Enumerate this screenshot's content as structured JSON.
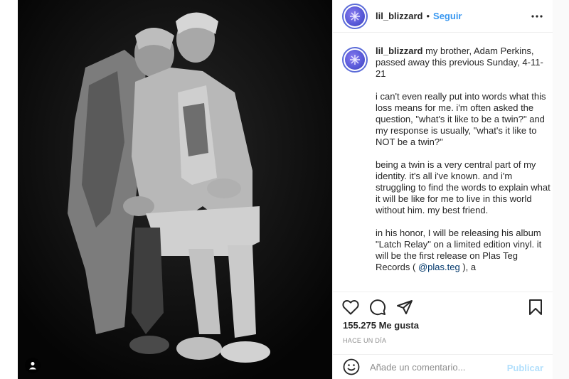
{
  "post": {
    "username": "lil_blizzard",
    "follow_label": "Seguir",
    "separator": "•",
    "photo_alt": "black-and-white portrait of two twins seated, one leaning on the other's shoulder"
  },
  "caption": {
    "username": "lil_blizzard",
    "first_line": " my brother, Adam Perkins, passed away this previous Sunday, 4-11-21",
    "paragraphs": [
      "i can't even really put into words what this loss means for me. i'm often asked the question, \"what's it like to be a twin?\" and my response is usually, \"what's it like to NOT be a twin?\"",
      "being a twin is a very central part of my identity. it's all i've known. and i'm struggling to find the words to explain what it will be like for me to live in this world without him. my best friend."
    ],
    "last_para_before": "in his honor, I will be releasing his album \"Latch Relay\" on a limited edition vinyl. it will be the first release on Plas Teg Records ( ",
    "mention": "@plas.teg",
    "last_para_after": " ), a"
  },
  "actions": {
    "icons": [
      "heart-icon",
      "comment-icon",
      "share-icon",
      "bookmark-icon"
    ]
  },
  "likes": {
    "text": "155.275 Me gusta"
  },
  "timestamp": "HACE UN DÍA",
  "comment": {
    "placeholder": "Añade un comentario...",
    "publish_label": "Publicar"
  },
  "colors": {
    "follow": "#3897f0",
    "publish_disabled": "#b2dffc",
    "avatar_ring": "#5b6bd8",
    "muted": "#8e8e8e"
  }
}
